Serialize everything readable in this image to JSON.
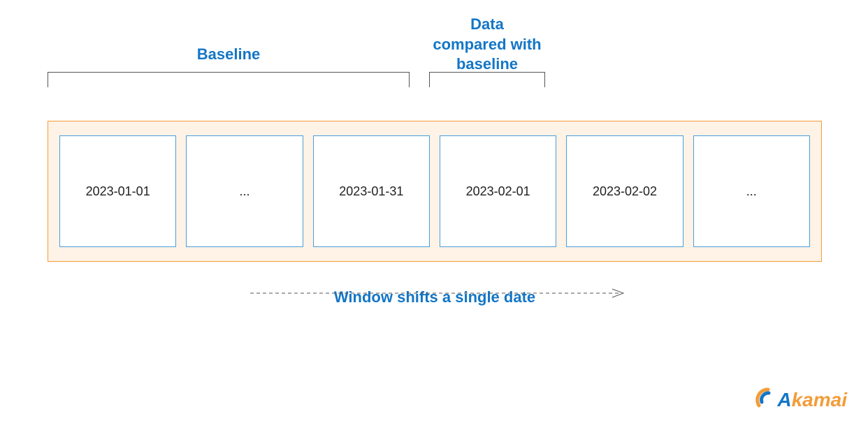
{
  "labels": {
    "baseline": "Baseline",
    "compared": "Data\ncompared with\nbaseline",
    "bottom": "Window shifts a single date"
  },
  "boxes": [
    "2023-01-01",
    "...",
    "2023-01-31",
    "2023-02-01",
    "2023-02-02",
    "..."
  ],
  "logo": {
    "brand_first": "A",
    "brand_rest": "kamai"
  },
  "colors": {
    "accent_blue": "#1476c6",
    "accent_orange": "#f39c3a",
    "window_bg": "#fef3e6",
    "box_border": "#4a9edb"
  }
}
